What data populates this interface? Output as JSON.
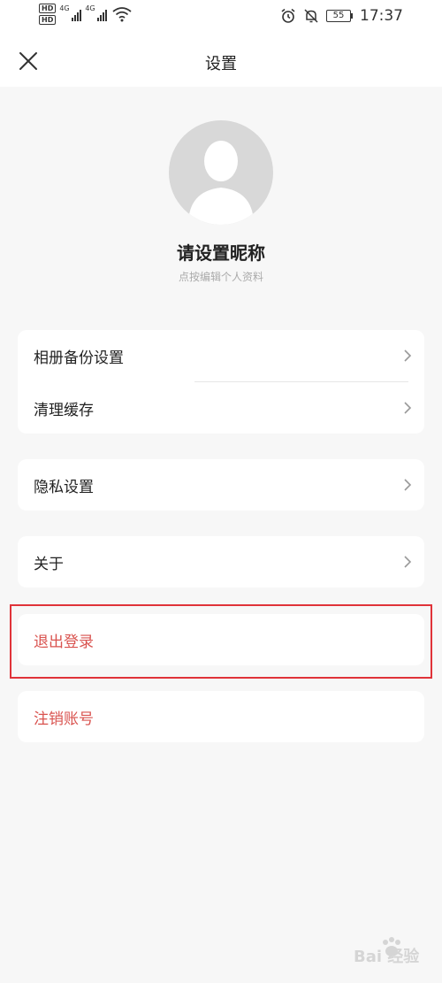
{
  "status_bar": {
    "hd1": "HD",
    "hd2": "HD",
    "net1": "4G",
    "net2": "4G",
    "battery": "55",
    "time": "17:37"
  },
  "navbar": {
    "title": "设置"
  },
  "profile": {
    "nickname": "请设置昵称",
    "subtitle": "点按编辑个人资料"
  },
  "menu": {
    "album_backup": "相册备份设置",
    "clear_cache": "清理缓存",
    "privacy": "隐私设置",
    "about": "关于",
    "logout": "退出登录",
    "deactivate": "注销账号"
  },
  "colors": {
    "danger": "#d9534f",
    "highlight": "#e03339",
    "background": "#f7f7f7"
  }
}
